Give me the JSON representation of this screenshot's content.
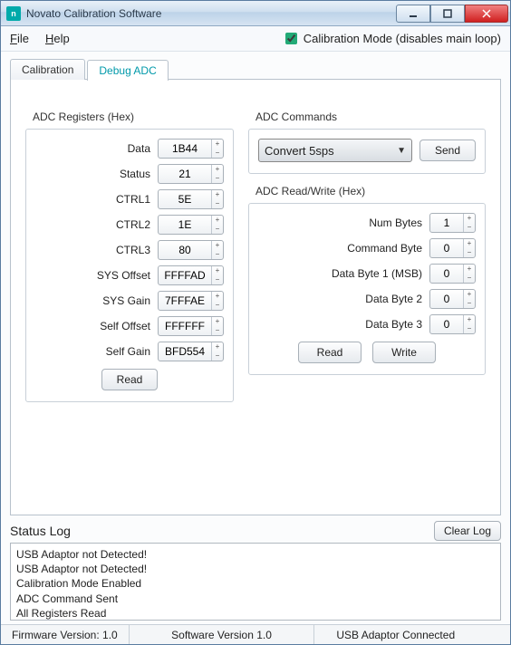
{
  "window": {
    "title": "Novato Calibration Software",
    "icon_text": "n"
  },
  "menu": {
    "file": "File",
    "help": "Help",
    "calibration_mode_label": "Calibration Mode (disables main loop)",
    "calibration_mode_checked": true
  },
  "tabs": {
    "calibration": "Calibration",
    "debug_adc": "Debug ADC"
  },
  "adc_registers": {
    "title": "ADC Registers (Hex)",
    "rows": [
      {
        "label": "Data",
        "value": "1B44"
      },
      {
        "label": "Status",
        "value": "21"
      },
      {
        "label": "CTRL1",
        "value": "5E"
      },
      {
        "label": "CTRL2",
        "value": "1E"
      },
      {
        "label": "CTRL3",
        "value": "80"
      },
      {
        "label": "SYS Offset",
        "value": "FFFFAD"
      },
      {
        "label": "SYS Gain",
        "value": "7FFFAE"
      },
      {
        "label": "Self Offset",
        "value": "FFFFFF"
      },
      {
        "label": "Self Gain",
        "value": "BFD554"
      }
    ],
    "read_button": "Read"
  },
  "adc_commands": {
    "title": "ADC Commands",
    "selected": "Convert 5sps",
    "send_button": "Send"
  },
  "adc_rw": {
    "title": "ADC Read/Write (Hex)",
    "rows": [
      {
        "label": "Num Bytes",
        "value": "1"
      },
      {
        "label": "Command Byte",
        "value": "0"
      },
      {
        "label": "Data Byte 1 (MSB)",
        "value": "0"
      },
      {
        "label": "Data Byte 2",
        "value": "0"
      },
      {
        "label": "Data Byte 3",
        "value": "0"
      }
    ],
    "read_button": "Read",
    "write_button": "Write"
  },
  "status_log": {
    "title": "Status Log",
    "clear_button": "Clear Log",
    "lines": [
      "USB Adaptor not Detected!",
      "USB Adaptor not Detected!",
      "Calibration Mode Enabled",
      "ADC Command Sent",
      "All Registers Read"
    ]
  },
  "statusbar": {
    "firmware": "Firmware Version: 1.0",
    "software": "Software Version 1.0",
    "usb": "USB Adaptor Connected"
  }
}
